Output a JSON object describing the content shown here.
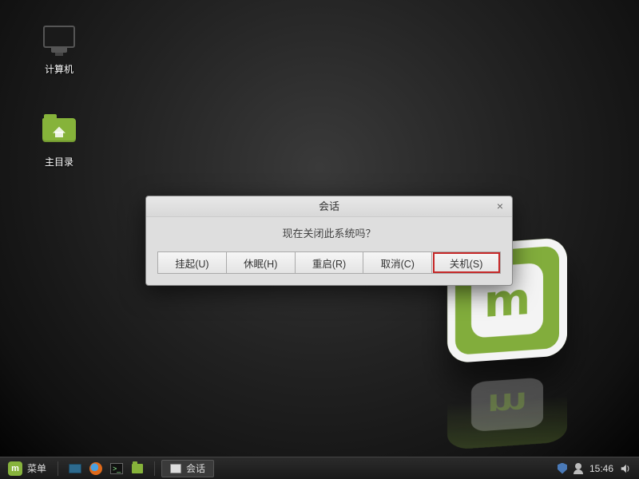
{
  "desktop": {
    "icons": {
      "computer_label": "计算机",
      "home_label": "主目录"
    }
  },
  "dialog": {
    "title": "会话",
    "message": "现在关闭此系统吗？",
    "close_symbol": "×",
    "buttons": {
      "suspend": "挂起(U)",
      "hibernate": "休眠(H)",
      "restart": "重启(R)",
      "cancel": "取消(C)",
      "shutdown": "关机(S)"
    }
  },
  "taskbar": {
    "menu_label": "菜单",
    "active_task_label": "会话",
    "clock": "15:46"
  },
  "branding": {
    "mint_letter": "m"
  }
}
